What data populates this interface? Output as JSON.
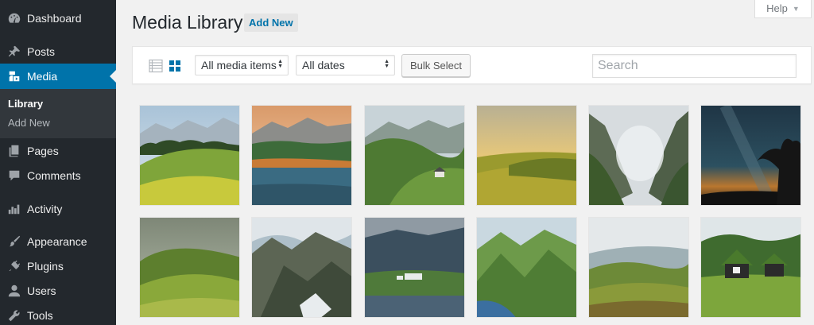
{
  "sidebar": {
    "items": [
      {
        "label": "Dashboard",
        "icon": "dashboard-icon"
      },
      {
        "label": "Posts",
        "icon": "pushpin-icon"
      },
      {
        "label": "Media",
        "icon": "media-icon"
      },
      {
        "label": "Pages",
        "icon": "pages-icon"
      },
      {
        "label": "Comments",
        "icon": "comment-bubble-icon"
      },
      {
        "label": "Activity",
        "icon": "activity-icon"
      },
      {
        "label": "Appearance",
        "icon": "paintbrush-icon"
      },
      {
        "label": "Plugins",
        "icon": "plug-icon"
      },
      {
        "label": "Users",
        "icon": "user-icon"
      },
      {
        "label": "Tools",
        "icon": "wrench-icon"
      }
    ],
    "submenu": [
      {
        "label": "Library"
      },
      {
        "label": "Add New"
      }
    ]
  },
  "header": {
    "title": "Media Library",
    "add_new_label": "Add New",
    "help_label": "Help"
  },
  "toolbar": {
    "media_filter": "All media items",
    "date_filter": "All dates",
    "bulk_select_label": "Bulk Select",
    "search_placeholder": "Search"
  },
  "colors": {
    "sidebar_bg": "#23282d",
    "active_bg": "#0073aa",
    "submenu_bg": "#32373c",
    "page_bg": "#f1f1f1"
  },
  "grid": {
    "items": [
      {
        "subject": "green rolling hill with forest and mountains"
      },
      {
        "subject": "mountain lake at sunset"
      },
      {
        "subject": "green valley with small house"
      },
      {
        "subject": "golden sunlit meadow"
      },
      {
        "subject": "misty mountain gorge"
      },
      {
        "subject": "starry night sky with tree silhouette"
      },
      {
        "subject": "green grassy hill under stormy sky"
      },
      {
        "subject": "rocky mountain ridge with snow"
      },
      {
        "subject": "lakeside church under cloudy mountains"
      },
      {
        "subject": "coastal green mountains"
      },
      {
        "subject": "rolling hills with hazy mountains"
      },
      {
        "subject": "turf-roof houses on green field"
      }
    ]
  }
}
